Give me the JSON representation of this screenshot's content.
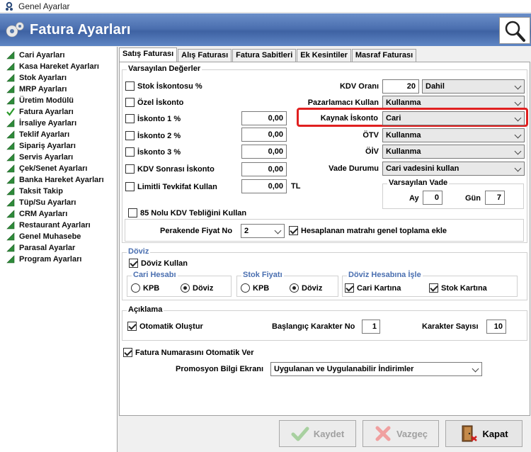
{
  "window": {
    "title": "Genel Ayarlar"
  },
  "header": {
    "title": "Fatura Ayarları",
    "gear_icon": "gears-icon",
    "search_icon": "search-icon"
  },
  "sidebar": {
    "items": [
      {
        "label": "Cari Ayarları",
        "icon": "green-triangle-icon"
      },
      {
        "label": "Kasa Hareket Ayarları",
        "icon": "green-triangle-icon"
      },
      {
        "label": "Stok Ayarları",
        "icon": "green-triangle-icon"
      },
      {
        "label": "MRP Ayarları",
        "icon": "green-triangle-icon"
      },
      {
        "label": "Üretim Modülü",
        "icon": "green-triangle-icon"
      },
      {
        "label": "Fatura Ayarları",
        "icon": "green-check-icon"
      },
      {
        "label": "İrsaliye Ayarları",
        "icon": "green-triangle-icon"
      },
      {
        "label": "Teklif Ayarları",
        "icon": "green-triangle-icon"
      },
      {
        "label": "Sipariş Ayarları",
        "icon": "green-triangle-icon"
      },
      {
        "label": "Servis Ayarları",
        "icon": "green-triangle-icon"
      },
      {
        "label": "Çek/Senet Ayarları",
        "icon": "green-triangle-icon"
      },
      {
        "label": "Banka Hareket Ayarları",
        "icon": "green-triangle-icon"
      },
      {
        "label": "Taksit Takip",
        "icon": "green-triangle-icon"
      },
      {
        "label": "Tüp/Su Ayarları",
        "icon": "green-triangle-icon"
      },
      {
        "label": "CRM Ayarları",
        "icon": "green-triangle-icon"
      },
      {
        "label": "Restaurant Ayarları",
        "icon": "green-triangle-icon"
      },
      {
        "label": "Genel Muhasebe",
        "icon": "green-triangle-icon"
      },
      {
        "label": "Parasal Ayarlar",
        "icon": "green-triangle-icon"
      },
      {
        "label": "Program Ayarları",
        "icon": "green-triangle-icon"
      }
    ]
  },
  "tabs": [
    {
      "label": "Satış Faturası",
      "active": true
    },
    {
      "label": "Alış Faturası",
      "active": false
    },
    {
      "label": "Fatura Sabitleri",
      "active": false
    },
    {
      "label": "Ek Kesintiler",
      "active": false
    },
    {
      "label": "Masraf Faturası",
      "active": false
    }
  ],
  "defaults": {
    "legend": "Varsayılan Değerler",
    "stok_iskontosu": {
      "label": "Stok İskontosu %",
      "checked": false
    },
    "ozel_iskonto": {
      "label": "Özel İskonto",
      "checked": false
    },
    "iskonto1": {
      "label": "İskonto 1 %",
      "checked": false,
      "value": "0,00"
    },
    "iskonto2": {
      "label": "İskonto 2 %",
      "checked": false,
      "value": "0,00"
    },
    "iskonto3": {
      "label": "İskonto 3 %",
      "checked": false,
      "value": "0,00"
    },
    "kdv_sonrasi": {
      "label": "KDV Sonrası İskonto",
      "checked": false,
      "value": "0,00"
    },
    "limitli_tevkifat": {
      "label": "Limitli Tevkifat Kullan",
      "checked": false,
      "value": "0,00",
      "unit": "TL"
    },
    "kdv_orani": {
      "label": "KDV Oranı",
      "value": "20",
      "select": "Dahil"
    },
    "pazarlamaci": {
      "label": "Pazarlamacı Kullan",
      "value": "Kullanma"
    },
    "kaynak_iskonto": {
      "label": "Kaynak İskonto",
      "value": "Cari"
    },
    "otv": {
      "label": "ÖTV",
      "value": "Kullanma"
    },
    "oiv": {
      "label": "ÖİV",
      "value": "Kullanma"
    },
    "vade_durumu": {
      "label": "Vade Durumu",
      "value": "Cari vadesini kullan"
    },
    "varsayilan_vade": {
      "legend": "Varsayılan Vade",
      "ay_label": "Ay",
      "ay_value": "0",
      "gun_label": "Gün",
      "gun_value": "7"
    },
    "kdv85": {
      "label": "85 Nolu KDV Tebliğini Kullan",
      "checked": false
    },
    "perakende": {
      "label": "Perakende Fiyat No",
      "value": "2"
    },
    "hesaplanan": {
      "label": "Hesaplanan matrahı genel toplama ekle",
      "checked": true
    }
  },
  "doviz": {
    "legend": "Döviz",
    "kullan": {
      "label": "Döviz Kullan",
      "checked": true
    },
    "cari": {
      "legend": "Cari Hesabı",
      "opt1": "KPB",
      "opt2": "Döviz",
      "selected": "Döviz"
    },
    "stok": {
      "legend": "Stok Fiyatı",
      "opt1": "KPB",
      "opt2": "Döviz",
      "selected": "Döviz"
    },
    "isle": {
      "legend": "Döviz Hesabına İşle",
      "cari": "Cari Kartına",
      "cari_checked": true,
      "stok": "Stok Kartına",
      "stok_checked": true
    }
  },
  "aciklama": {
    "legend": "Açıklama",
    "otomatik": {
      "label": "Otomatik Oluştur",
      "checked": true
    },
    "baslangic": {
      "label": "Başlangıç Karakter No",
      "value": "1"
    },
    "karakter": {
      "label": "Karakter Sayısı",
      "value": "10"
    }
  },
  "fatura_no": {
    "label": "Fatura Numarasını Otomatik Ver",
    "checked": true
  },
  "promosyon": {
    "label": "Promosyon Bilgi Ekranı",
    "value": "Uygulanan ve Uygulanabilir İndirimler"
  },
  "buttons": {
    "kaydet": "Kaydet",
    "vazgec": "Vazgeç",
    "kapat": "Kapat"
  },
  "colors": {
    "header": "#4c70b0",
    "highlight": "#e02020",
    "legend_blue": "#4a6fb0"
  }
}
